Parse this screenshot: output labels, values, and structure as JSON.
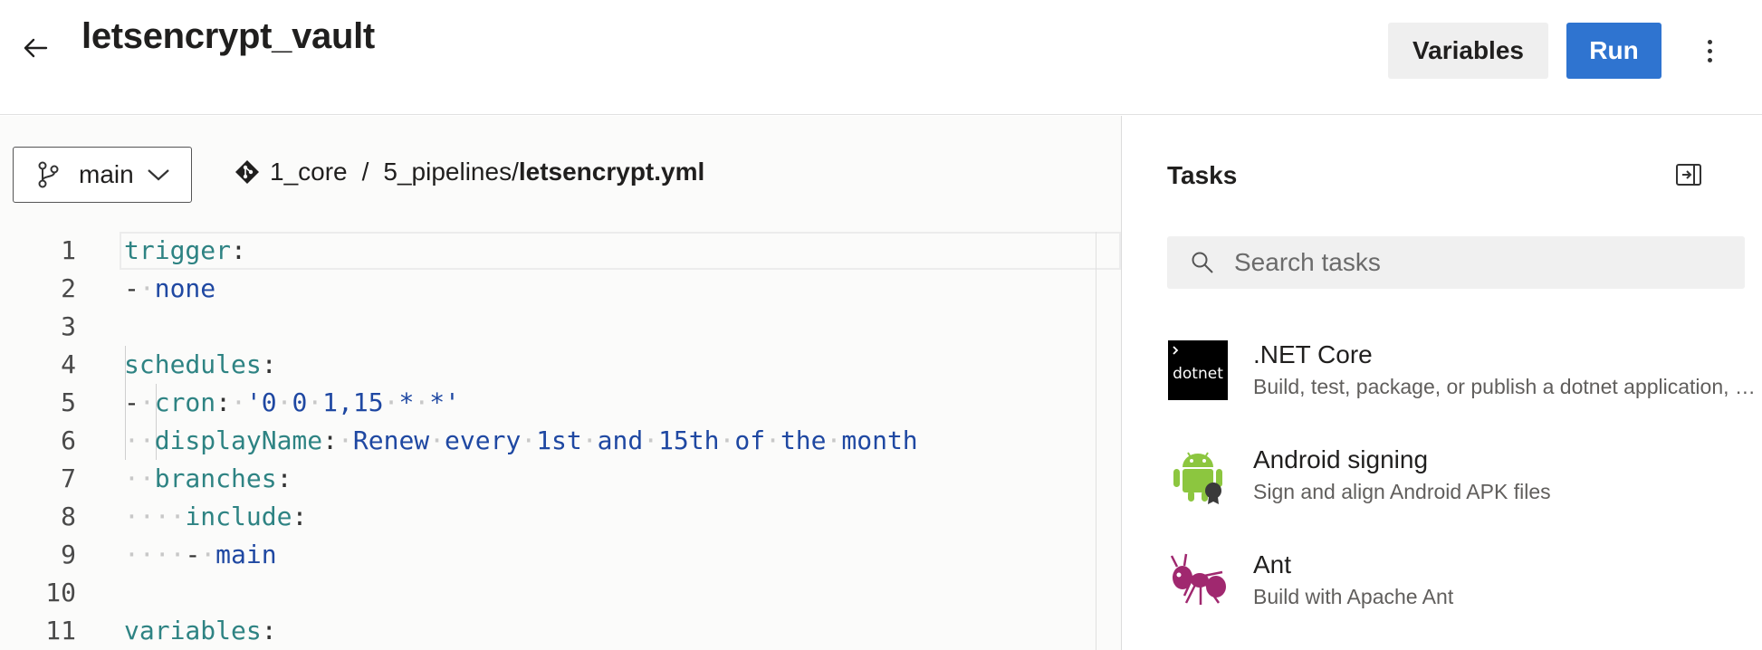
{
  "header": {
    "title": "letsencrypt_vault",
    "variables_label": "Variables",
    "run_label": "Run"
  },
  "editor": {
    "branch": "main",
    "path": {
      "repo": "1_core",
      "separator": "/",
      "folder": "5_pipelines/",
      "file": "letsencrypt.yml"
    },
    "lines": [
      {
        "n": "1",
        "parts": [
          [
            "k",
            "trigger"
          ],
          [
            "p",
            ":"
          ]
        ]
      },
      {
        "n": "2",
        "parts": [
          [
            "p",
            "-"
          ],
          [
            "ws",
            "·"
          ],
          [
            "v",
            "none"
          ]
        ]
      },
      {
        "n": "3",
        "parts": []
      },
      {
        "n": "4",
        "parts": [
          [
            "k",
            "schedules"
          ],
          [
            "p",
            ":"
          ]
        ]
      },
      {
        "n": "5",
        "parts": [
          [
            "p",
            "-"
          ],
          [
            "ws",
            "·"
          ],
          [
            "k",
            "cron"
          ],
          [
            "p",
            ":"
          ],
          [
            "ws",
            "·"
          ],
          [
            "v",
            "'0"
          ],
          [
            "ws",
            "·"
          ],
          [
            "v",
            "0"
          ],
          [
            "ws",
            "·"
          ],
          [
            "v",
            "1,15"
          ],
          [
            "ws",
            "·"
          ],
          [
            "v",
            "*"
          ],
          [
            "ws",
            "·"
          ],
          [
            "v",
            "*'"
          ]
        ]
      },
      {
        "n": "6",
        "parts": [
          [
            "ws",
            "··"
          ],
          [
            "k",
            "displayName"
          ],
          [
            "p",
            ":"
          ],
          [
            "ws",
            "·"
          ],
          [
            "v",
            "Renew"
          ],
          [
            "ws",
            "·"
          ],
          [
            "v",
            "every"
          ],
          [
            "ws",
            "·"
          ],
          [
            "v",
            "1st"
          ],
          [
            "ws",
            "·"
          ],
          [
            "v",
            "and"
          ],
          [
            "ws",
            "·"
          ],
          [
            "v",
            "15th"
          ],
          [
            "ws",
            "·"
          ],
          [
            "v",
            "of"
          ],
          [
            "ws",
            "·"
          ],
          [
            "v",
            "the"
          ],
          [
            "ws",
            "·"
          ],
          [
            "v",
            "month"
          ]
        ]
      },
      {
        "n": "7",
        "parts": [
          [
            "ws",
            "··"
          ],
          [
            "k",
            "branches"
          ],
          [
            "p",
            ":"
          ]
        ]
      },
      {
        "n": "8",
        "parts": [
          [
            "ws",
            "····"
          ],
          [
            "k",
            "include"
          ],
          [
            "p",
            ":"
          ]
        ]
      },
      {
        "n": "9",
        "parts": [
          [
            "ws",
            "····"
          ],
          [
            "p",
            "-"
          ],
          [
            "ws",
            "·"
          ],
          [
            "v",
            "main"
          ]
        ]
      },
      {
        "n": "10",
        "parts": []
      },
      {
        "n": "11",
        "parts": [
          [
            "k",
            "variables"
          ],
          [
            "p",
            ":"
          ]
        ]
      }
    ]
  },
  "tasks": {
    "title": "Tasks",
    "search_placeholder": "Search tasks",
    "items": [
      {
        "name": ".NET Core",
        "description": "Build, test, package, or publish a dotnet application, or run a custom dotnet command",
        "icon": "dotnet-icon",
        "icon_text": "dotnet"
      },
      {
        "name": "Android signing",
        "description": "Sign and align Android APK files",
        "icon": "android-icon"
      },
      {
        "name": "Ant",
        "description": "Build with Apache Ant",
        "icon": "ant-icon"
      }
    ]
  },
  "colors": {
    "run_button": "#2f74d0",
    "yaml_key": "#2e8383",
    "yaml_value": "#1f48a2"
  }
}
